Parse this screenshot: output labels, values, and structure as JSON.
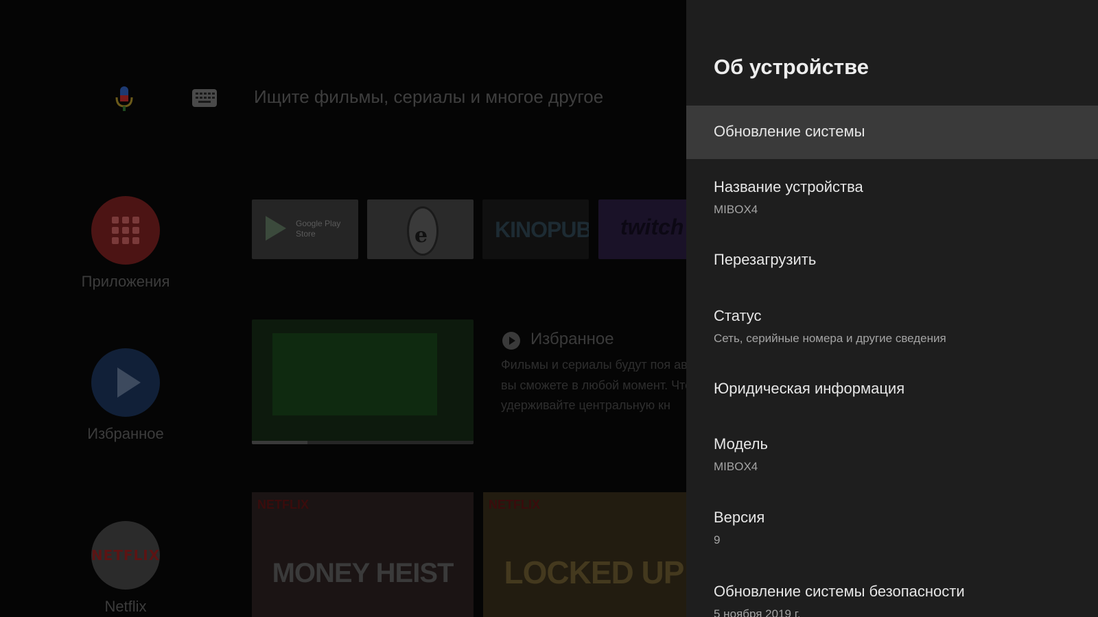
{
  "launcher": {
    "search_placeholder": "Ищите фильмы, сериалы и многое другое",
    "sidebar": [
      {
        "label": "Приложения"
      },
      {
        "label": "Избранное"
      },
      {
        "label": "Netflix"
      }
    ],
    "netflix_logo": "NETFLIX",
    "app_tiles": {
      "google_play": "Google Play\nStore",
      "kinopub": "KINOPUB",
      "twitch": "twitch"
    },
    "favorites_row": {
      "title": "Избранное",
      "description": "Фильмы и сериалы будут поя автоматически, и вы сможете в любой момент. Чтобы доба удерживайте центральную кн",
      "progress": 0.25
    },
    "posters": [
      {
        "badge": "NETFLIX",
        "title": "MONEY HEIST"
      },
      {
        "badge": "NETFLIX",
        "title": "LOCKED UP"
      }
    ]
  },
  "panel": {
    "title": "Об устройстве",
    "items": [
      {
        "title": "Обновление системы",
        "subtitle": ""
      },
      {
        "title": "Название устройства",
        "subtitle": "MIBOX4"
      },
      {
        "title": "Перезагрузить",
        "subtitle": ""
      },
      {
        "title": "Статус",
        "subtitle": "Сеть, серийные номера и другие сведения"
      },
      {
        "title": "Юридическая информация",
        "subtitle": ""
      },
      {
        "title": "Модель",
        "subtitle": "MIBOX4"
      },
      {
        "title": "Версия",
        "subtitle": "9"
      },
      {
        "title": "Обновление системы безопасности",
        "subtitle": "5 ноября 2019 г."
      }
    ]
  },
  "colors": {
    "panel_bg": "#1e1e1e",
    "focused_item_bg": "#3a3a3a",
    "primary_text": "#e6e6e6",
    "secondary_text": "#a4a4a4"
  }
}
